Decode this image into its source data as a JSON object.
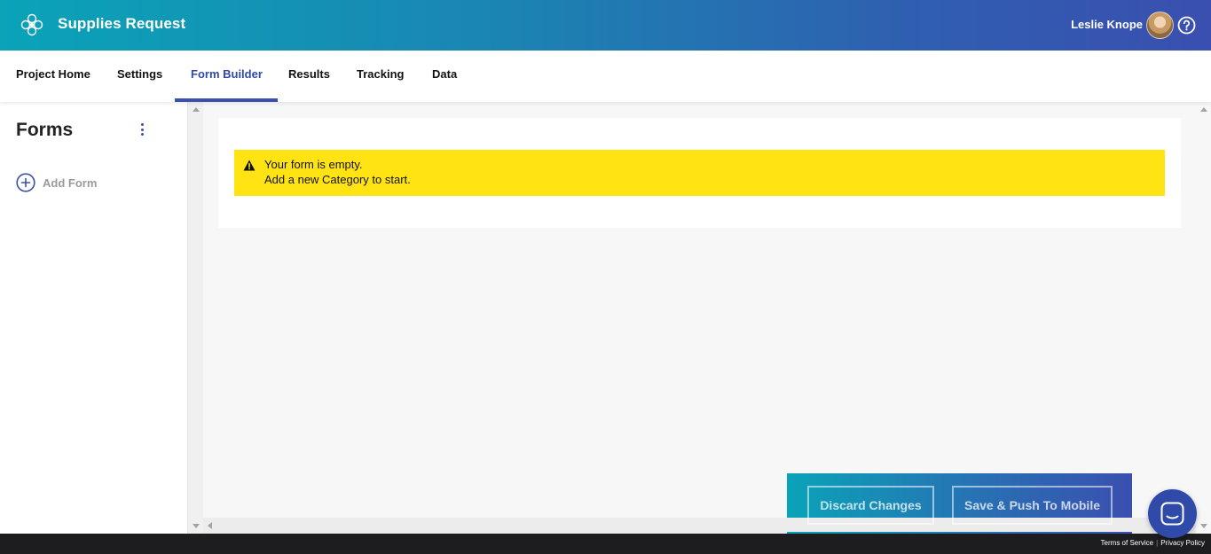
{
  "header": {
    "app_title": "Supplies Request",
    "user_name": "Leslie Knope",
    "icons": {
      "logo": "clover-logo-icon",
      "help": "help-circle-icon",
      "avatar": "user-avatar"
    }
  },
  "tabs": [
    {
      "label": "Project Home",
      "active": false
    },
    {
      "label": "Settings",
      "active": false
    },
    {
      "label": "Form Builder",
      "active": true
    },
    {
      "label": "Results",
      "active": false
    },
    {
      "label": "Tracking",
      "active": false
    },
    {
      "label": "Data",
      "active": false
    }
  ],
  "sidebar": {
    "title": "Forms",
    "add_form_label": "Add Form"
  },
  "main": {
    "alert": {
      "line1": "Your form is empty.",
      "line2": "Add a new Category to start."
    }
  },
  "actions": {
    "discard_label": "Discard Changes",
    "save_label": "Save & Push To Mobile"
  },
  "footer": {
    "terms_label": "Terms of Service",
    "separator": "|",
    "privacy_label": "Privacy Policy"
  },
  "colors": {
    "brand_teal": "#0aa3b8",
    "brand_indigo": "#3a4fb0",
    "alert_yellow": "#ffe312",
    "footer_bg": "#1d1d1f"
  }
}
